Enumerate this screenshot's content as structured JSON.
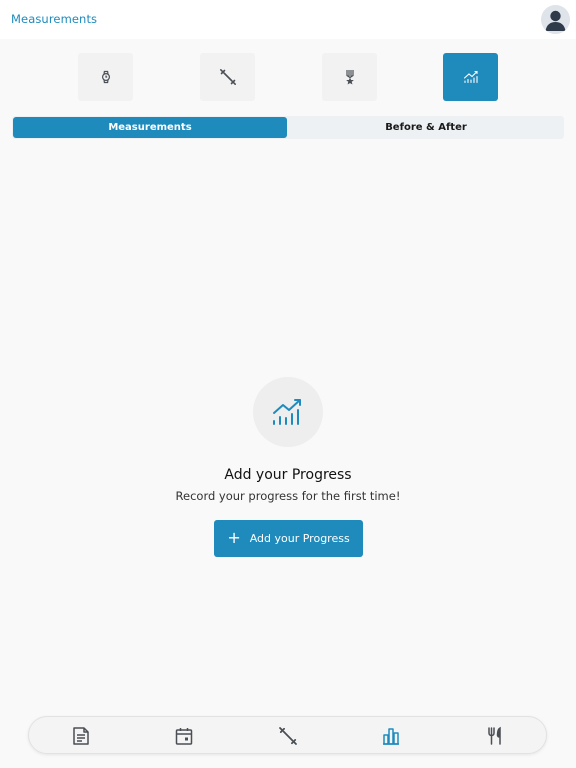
{
  "header": {
    "title": "Measurements",
    "avatar_icon": "user-avatar-icon"
  },
  "categories": [
    {
      "icon": "watch-icon",
      "active": false
    },
    {
      "icon": "dumbbell-icon",
      "active": false
    },
    {
      "icon": "medal-icon",
      "active": false
    },
    {
      "icon": "progress-chart-icon",
      "active": true
    }
  ],
  "segments": {
    "measurements": "Measurements",
    "before_after": "Before & After",
    "selected": "measurements"
  },
  "empty_state": {
    "icon": "progress-chart-icon",
    "title": "Add your Progress",
    "subtitle": "Record your progress for the first time!",
    "button_icon": "plus-icon",
    "button_label": "Add your Progress"
  },
  "bottom_nav": [
    {
      "icon": "notes-icon",
      "active": false
    },
    {
      "icon": "calendar-icon",
      "active": false
    },
    {
      "icon": "dumbbell-icon",
      "active": false
    },
    {
      "icon": "bar-chart-icon",
      "active": true
    },
    {
      "icon": "fork-knife-icon",
      "active": false
    }
  ],
  "colors": {
    "accent": "#1f8bbd",
    "icon_gray": "#4a4f55",
    "background": "#f9f9f9"
  }
}
